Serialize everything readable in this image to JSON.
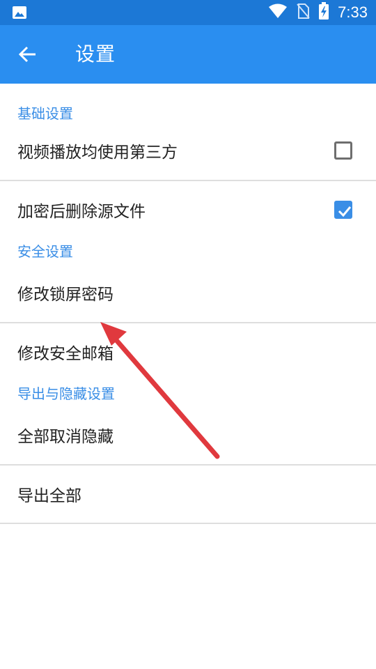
{
  "status_bar": {
    "time": "7:33",
    "icons": [
      "image-icon",
      "wifi-icon",
      "no-sim-icon",
      "battery-charging-icon"
    ]
  },
  "app_bar": {
    "title": "设置",
    "back_icon": "arrow-back-icon"
  },
  "sections": [
    {
      "header": "基础设置",
      "items": [
        {
          "label": "视频播放均使用第三方",
          "checkbox": "unchecked"
        },
        {
          "label": "加密后删除源文件",
          "checkbox": "checked"
        }
      ]
    },
    {
      "header": "安全设置",
      "items": [
        {
          "label": "修改锁屏密码"
        },
        {
          "label": "修改安全邮箱"
        }
      ]
    },
    {
      "header": "导出与隐藏设置",
      "items": [
        {
          "label": "全部取消隐藏"
        },
        {
          "label": "导出全部"
        }
      ]
    }
  ],
  "colors": {
    "status_bar": "#1c78d6",
    "app_bar": "#2a8ef0",
    "accent": "#3a8ee6",
    "annotation_arrow": "#e0393e"
  }
}
